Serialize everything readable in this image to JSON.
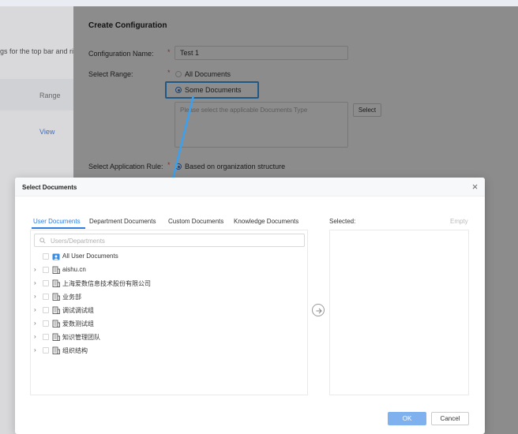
{
  "background": {
    "left_text": "gs for the top bar and rig",
    "left_range": "Range",
    "left_view": "View"
  },
  "config": {
    "title": "Create Configuration",
    "name_label": "Configuration Name:",
    "name_value": "Test 1",
    "range_label": "Select Range:",
    "range_options": [
      "All Documents",
      "Some Documents"
    ],
    "range_selected": "Some Documents",
    "doc_type_placeholder": "Please select the applicable Documents Type",
    "select_button": "Select",
    "rule_label": "Select Application Rule:",
    "rule_value": "Based on organization structure"
  },
  "dialog": {
    "title": "Select Documents",
    "tabs": [
      "User Documents",
      "Department Documents",
      "Custom Documents",
      "Knowledge Documents"
    ],
    "active_tab": "User Documents",
    "search_placeholder": "Users/Departments",
    "tree": [
      {
        "label": "All User Documents",
        "icon": "user-folder-icon",
        "expandable": false
      },
      {
        "label": "aishu.cn",
        "icon": "building-icon",
        "expandable": true
      },
      {
        "label": "上海爱数信息技术股份有限公司",
        "icon": "building-icon",
        "expandable": true
      },
      {
        "label": "业务部",
        "icon": "building-icon",
        "expandable": true
      },
      {
        "label": "调试调试组",
        "icon": "building-icon",
        "expandable": true
      },
      {
        "label": "爱数测试组",
        "icon": "building-icon",
        "expandable": true
      },
      {
        "label": "知识管理团队",
        "icon": "building-icon",
        "expandable": true
      },
      {
        "label": "组织结构",
        "icon": "building-icon",
        "expandable": true
      }
    ],
    "selected_label": "Selected:",
    "empty_label": "Empty",
    "ok_label": "OK",
    "cancel_label": "Cancel"
  },
  "colors": {
    "accent": "#2f7de1",
    "highlight": "#3aa0f0",
    "ok_disabled": "#7fb1ee"
  }
}
